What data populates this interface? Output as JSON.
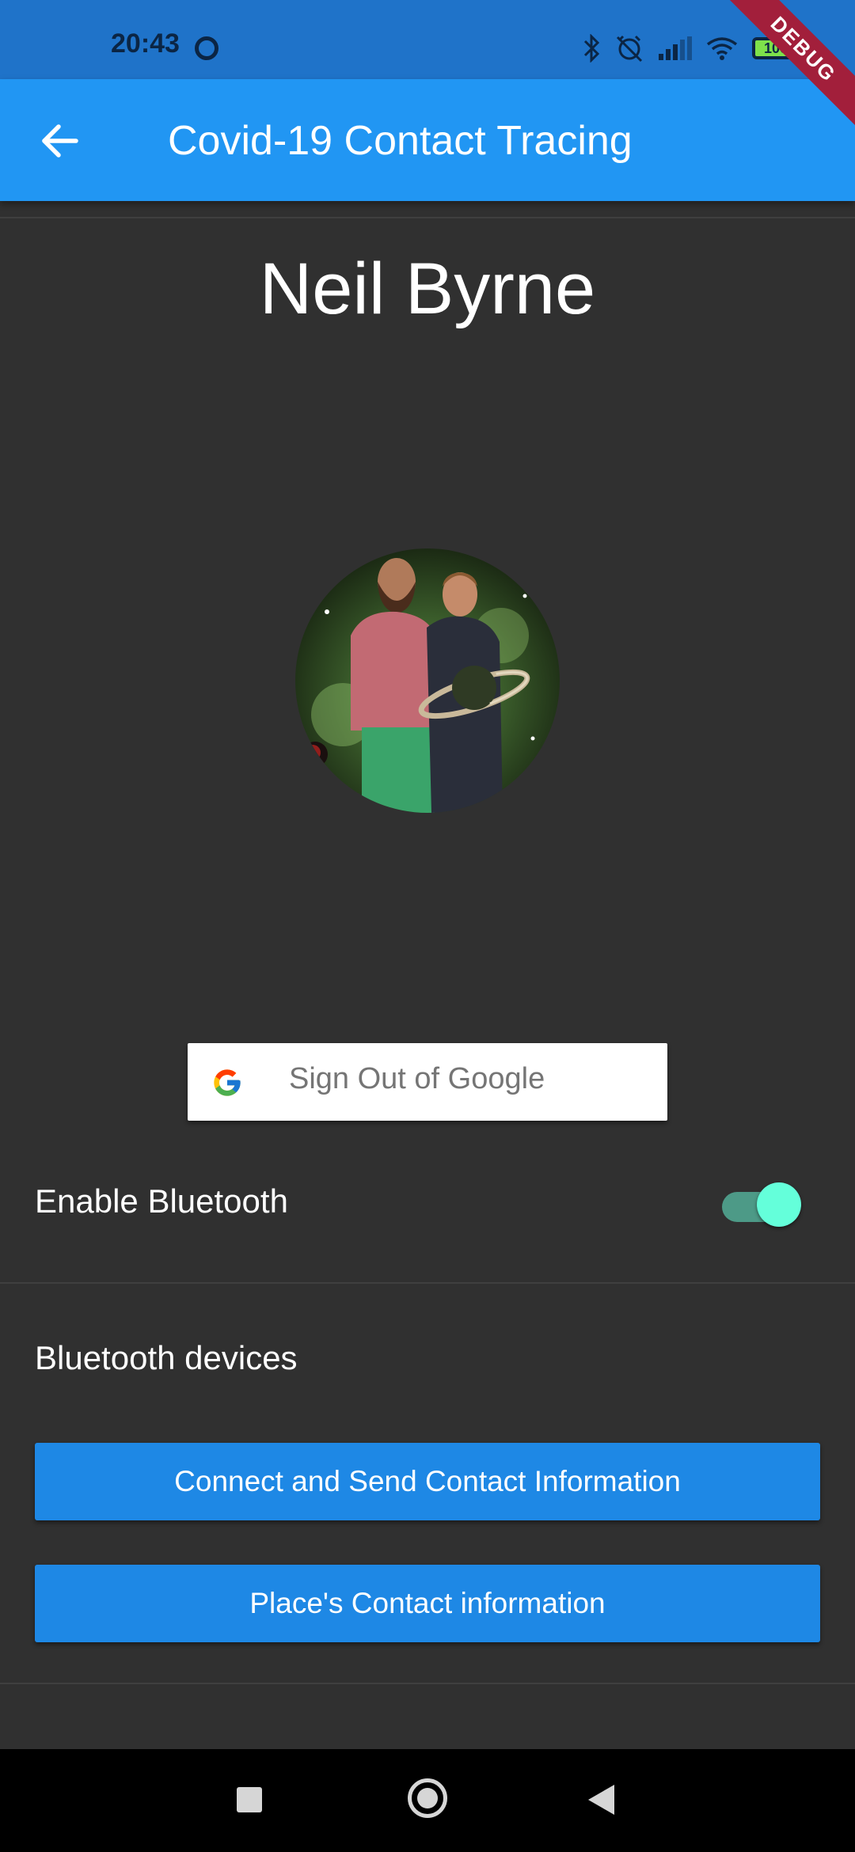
{
  "status_bar": {
    "time": "20:43",
    "battery_level": "100",
    "icons": [
      "sync-icon",
      "bluetooth-icon",
      "alarm-off-icon",
      "signal-icon",
      "wifi-icon",
      "battery-icon"
    ]
  },
  "debug_banner": "DEBUG",
  "app_bar": {
    "title": "Covid-19 Contact Tracing",
    "back_icon": "arrow-back-icon"
  },
  "profile": {
    "name": "Neil Byrne",
    "avatar_icon": "user-avatar-photo"
  },
  "google_button": {
    "label": "Sign Out of Google",
    "icon": "google-g-icon"
  },
  "bluetooth": {
    "label": "Enable Bluetooth",
    "enabled": true,
    "devices_label": "Bluetooth devices"
  },
  "buttons": {
    "connect_send": "Connect and Send Contact Information",
    "place_contact": "Place's Contact information"
  },
  "colors": {
    "app_bar": "#2196f3",
    "status_bar": "#1f73c9",
    "background": "#303030",
    "button": "#1e88e5",
    "switch_thumb": "#64ffda",
    "switch_track": "#4d9a87"
  },
  "nav_bar": {
    "icons": [
      "recents-icon",
      "home-icon",
      "back-icon"
    ]
  }
}
